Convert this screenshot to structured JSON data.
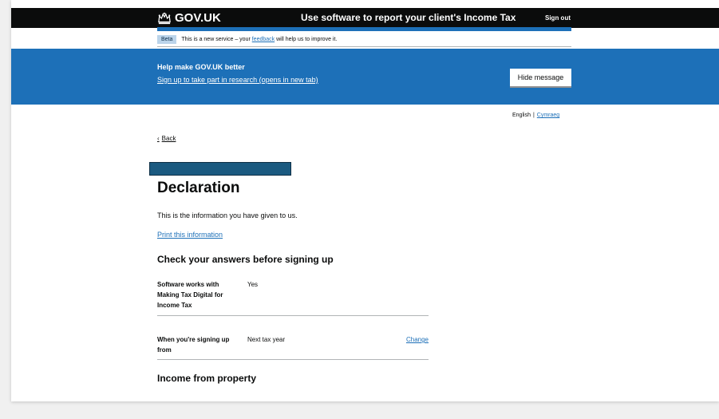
{
  "header": {
    "logo_text": "GOV.UK",
    "service_name": "Use software to report your client's Income Tax",
    "sign_out": "Sign out"
  },
  "beta_banner": {
    "tag": "Beta",
    "text_before": "This is a new service – your",
    "feedback_link": "feedback",
    "text_after": "will help us to improve it."
  },
  "research_banner": {
    "title": "Help make GOV.UK better",
    "link": "Sign up to take part in research (opens in new tab)",
    "hide_button": "Hide message"
  },
  "language": {
    "english": "English",
    "separator": "|",
    "welsh": "Cymraeg"
  },
  "back_link": "Back",
  "page": {
    "title": "Declaration",
    "lede": "This is the information you have given to us.",
    "print_link": "Print this information",
    "check_heading": "Check your answers before signing up",
    "income_heading": "Income from property"
  },
  "summary": [
    {
      "key": "Software works with Making Tax Digital for Income Tax",
      "value": "Yes",
      "action": ""
    },
    {
      "key": "When you're signing up from",
      "value": "Next tax year",
      "action": "Change"
    }
  ],
  "colors": {
    "brand_blue": "#1d70b8",
    "header_black": "#0b0c0c",
    "redaction": "#1b5a80"
  }
}
